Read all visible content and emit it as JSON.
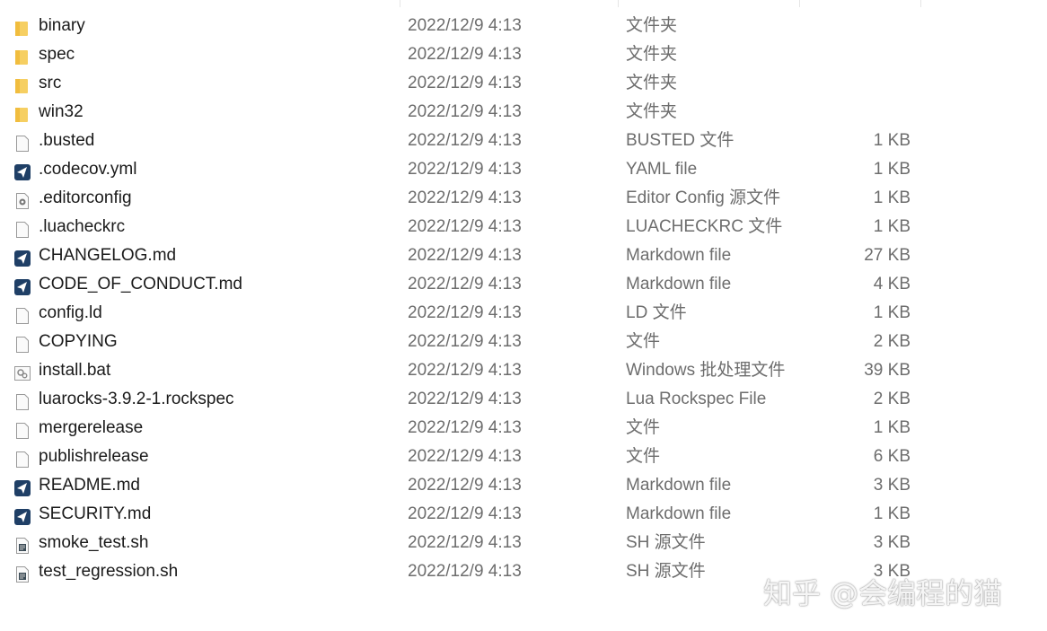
{
  "files": [
    {
      "name": "binary",
      "date": "2022/12/9 4:13",
      "type": "文件夹",
      "size": "",
      "icon": "folder-icon"
    },
    {
      "name": "spec",
      "date": "2022/12/9 4:13",
      "type": "文件夹",
      "size": "",
      "icon": "folder-icon"
    },
    {
      "name": "src",
      "date": "2022/12/9 4:13",
      "type": "文件夹",
      "size": "",
      "icon": "folder-icon"
    },
    {
      "name": "win32",
      "date": "2022/12/9 4:13",
      "type": "文件夹",
      "size": "",
      "icon": "folder-icon"
    },
    {
      "name": ".busted",
      "date": "2022/12/9 4:13",
      "type": "BUSTED 文件",
      "size": "1 KB",
      "icon": "file-icon"
    },
    {
      "name": ".codecov.yml",
      "date": "2022/12/9 4:13",
      "type": "YAML file",
      "size": "1 KB",
      "icon": "app-file-icon"
    },
    {
      "name": ".editorconfig",
      "date": "2022/12/9 4:13",
      "type": "Editor Config 源文件",
      "size": "1 KB",
      "icon": "config-file-icon"
    },
    {
      "name": ".luacheckrc",
      "date": "2022/12/9 4:13",
      "type": "LUACHECKRC 文件",
      "size": "1 KB",
      "icon": "file-icon"
    },
    {
      "name": "CHANGELOG.md",
      "date": "2022/12/9 4:13",
      "type": "Markdown file",
      "size": "27 KB",
      "icon": "app-file-icon"
    },
    {
      "name": "CODE_OF_CONDUCT.md",
      "date": "2022/12/9 4:13",
      "type": "Markdown file",
      "size": "4 KB",
      "icon": "app-file-icon"
    },
    {
      "name": "config.ld",
      "date": "2022/12/9 4:13",
      "type": "LD 文件",
      "size": "1 KB",
      "icon": "file-icon"
    },
    {
      "name": "COPYING",
      "date": "2022/12/9 4:13",
      "type": "文件",
      "size": "2 KB",
      "icon": "file-icon"
    },
    {
      "name": "install.bat",
      "date": "2022/12/9 4:13",
      "type": "Windows 批处理文件",
      "size": "39 KB",
      "icon": "batch-file-icon"
    },
    {
      "name": "luarocks-3.9.2-1.rockspec",
      "date": "2022/12/9 4:13",
      "type": "Lua Rockspec File",
      "size": "2 KB",
      "icon": "file-icon"
    },
    {
      "name": "mergerelease",
      "date": "2022/12/9 4:13",
      "type": "文件",
      "size": "1 KB",
      "icon": "file-icon"
    },
    {
      "name": "publishrelease",
      "date": "2022/12/9 4:13",
      "type": "文件",
      "size": "6 KB",
      "icon": "file-icon"
    },
    {
      "name": "README.md",
      "date": "2022/12/9 4:13",
      "type": "Markdown file",
      "size": "3 KB",
      "icon": "app-file-icon"
    },
    {
      "name": "SECURITY.md",
      "date": "2022/12/9 4:13",
      "type": "Markdown file",
      "size": "1 KB",
      "icon": "app-file-icon"
    },
    {
      "name": "smoke_test.sh",
      "date": "2022/12/9 4:13",
      "type": "SH 源文件",
      "size": "3 KB",
      "icon": "script-file-icon"
    },
    {
      "name": "test_regression.sh",
      "date": "2022/12/9 4:13",
      "type": "SH 源文件",
      "size": "3 KB",
      "icon": "script-file-icon"
    }
  ],
  "watermark": "知乎 @会编程的猫"
}
